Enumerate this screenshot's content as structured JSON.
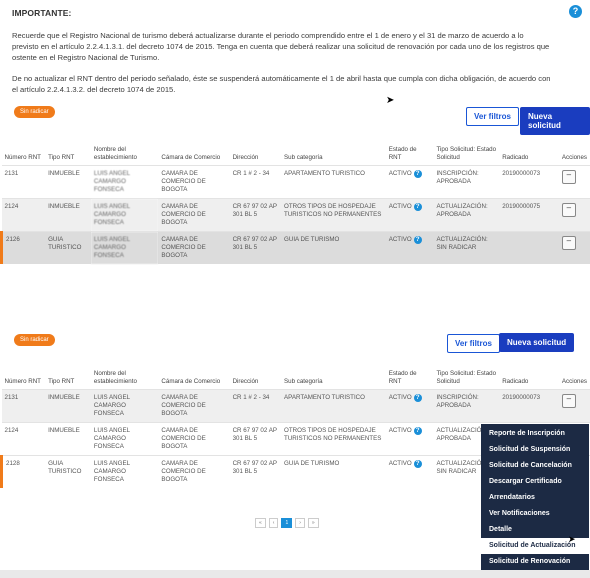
{
  "notice": {
    "title": "IMPORTANTE:",
    "help_icon": "?",
    "paragraph1": "Recuerde que el Registro Nacional de turismo deberá actualizarse durante el periodo comprendido entre el 1 de enero y el 31 de marzo de acuerdo a lo previsto en el artículo 2.2.4.1.3.1. del decreto 1074 de 2015. Tenga en cuenta que deberá realizar una solicitud de renovación por cada uno de los registros que ostente en el Registro Nacional de Turismo.",
    "paragraph2": "De no actualizar el RNT dentro del periodo señalado, éste se suspenderá automáticamente el 1 de abril hasta que cumpla con dicha obligación, de acuerdo con el artículo 2.2.4.1.3.2. del decreto 1074 de 2015."
  },
  "toolbar": {
    "badge": "Sin radicar",
    "filters_button": "Ver filtros",
    "new_button": "Nueva solicitud"
  },
  "table": {
    "headers": [
      "Número RNT",
      "Tipo RNT",
      "Nombre del establecimiento",
      "Cámara de Comercio",
      "Dirección",
      "Sub categoría",
      "Estado de RNT",
      "Tipo Solicitud: Estado Solicitud",
      "Radicado",
      "Acciones"
    ],
    "rows_top": [
      {
        "rnt": "2131",
        "tipo": "INMUEBLE",
        "nombre": "LUIS ANGEL CAMARGO FONSECA",
        "camara": "CAMARA DE COMERCIO DE BOGOTA",
        "direccion": "CR 1 # 2 - 34",
        "subcat": "APARTAMENTO TURISTICO",
        "estado": "ACTIVO",
        "solicitud": "INSCRIPCIÓN: APROBADA",
        "radicado": "20190000073"
      },
      {
        "rnt": "2124",
        "tipo": "INMUEBLE",
        "nombre": "LUIS ANGEL CAMARGO FONSECA",
        "camara": "CAMARA DE COMERCIO DE BOGOTA",
        "direccion": "CR 67 97 02 AP 301 BL 5",
        "subcat": "OTROS TIPOS DE HOSPEDAJE TURISTICOS NO PERMANENTES",
        "estado": "ACTIVO",
        "solicitud": "ACTUALIZACIÓN: APROBADA",
        "radicado": "20190000075"
      },
      {
        "rnt": "2126",
        "tipo": "GUIA TURISTICO",
        "nombre": "LUIS ANGEL CAMARGO FONSECA",
        "camara": "CAMARA DE COMERCIO DE BOGOTA",
        "direccion": "CR 67 97 02 AP 301 BL 5",
        "subcat": "GUIA DE TURISMO",
        "estado": "ACTIVO",
        "solicitud": "ACTUALIZACIÓN: SIN RADICAR",
        "radicado": ""
      }
    ],
    "rows_bottom": [
      {
        "rnt": "2131",
        "tipo": "INMUEBLE",
        "nombre": "LUIS ANGEL CAMARGO FONSECA",
        "camara": "CAMARA DE COMERCIO DE BOGOTA",
        "direccion": "CR 1 # 2 - 34",
        "subcat": "APARTAMENTO TURISTICO",
        "estado": "ACTIVO",
        "solicitud": "INSCRIPCIÓN: APROBADA",
        "radicado": "20190000073"
      },
      {
        "rnt": "2124",
        "tipo": "INMUEBLE",
        "nombre": "LUIS ANGEL CAMARGO FONSECA",
        "camara": "CAMARA DE COMERCIO DE BOGOTA",
        "direccion": "CR 67 97 02 AP 301 BL 5",
        "subcat": "OTROS TIPOS DE HOSPEDAJE TURISTICOS NO PERMANENTES",
        "estado": "ACTIVO",
        "solicitud": "ACTUALIZACIÓN: APROBADA",
        "radicado": ""
      },
      {
        "rnt": "2128",
        "tipo": "GUIA TURISTICO",
        "nombre": "LUIS ANGEL CAMARGO FONSECA",
        "camara": "CAMARA DE COMERCIO DE BOGOTA",
        "direccion": "CR 67 97 02 AP 301 BL 5",
        "subcat": "GUIA DE TURISMO",
        "estado": "ACTIVO",
        "solicitud": "ACTUALIZACIÓN: SIN RADICAR",
        "radicado": ""
      }
    ],
    "action_symbol": "–"
  },
  "actions_menu": [
    "Reporte de Inscripción",
    "Solicitud de Suspensión",
    "Solicitud de Cancelación",
    "Descargar Certificado",
    "Arrendatarios",
    "Ver Notificaciones",
    "Detalle",
    "Solicitud de Actualización",
    "Solicitud de Renovación"
  ],
  "pagination": {
    "first": "«",
    "prev": "‹",
    "current": "1",
    "next": "›",
    "last": "»"
  },
  "colors": {
    "accent": "#1a3dbf",
    "badge": "#f07b1a",
    "info": "#1a8fd8",
    "menu": "#1c2a44"
  }
}
